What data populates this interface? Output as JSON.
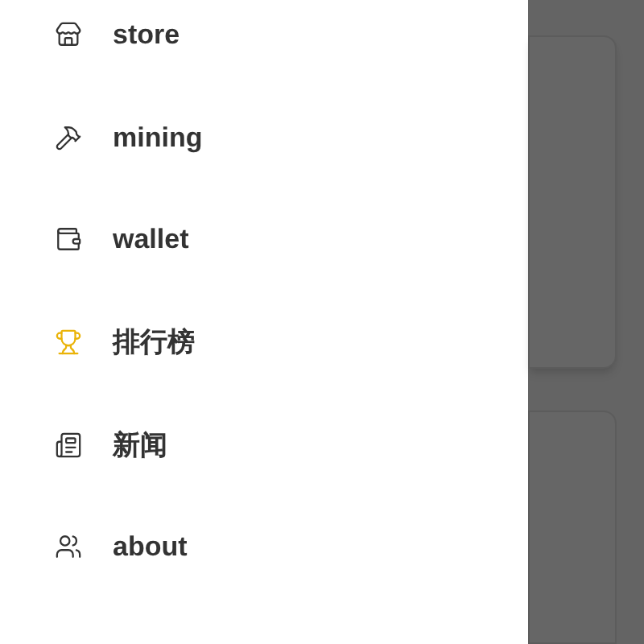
{
  "menu": {
    "items": [
      {
        "label": "store",
        "selected": false
      },
      {
        "label": "mining",
        "selected": false
      },
      {
        "label": "wallet",
        "selected": false
      },
      {
        "label": "排行榜",
        "selected": true
      },
      {
        "label": "新闻",
        "selected": false
      },
      {
        "label": "about",
        "selected": false
      }
    ]
  }
}
